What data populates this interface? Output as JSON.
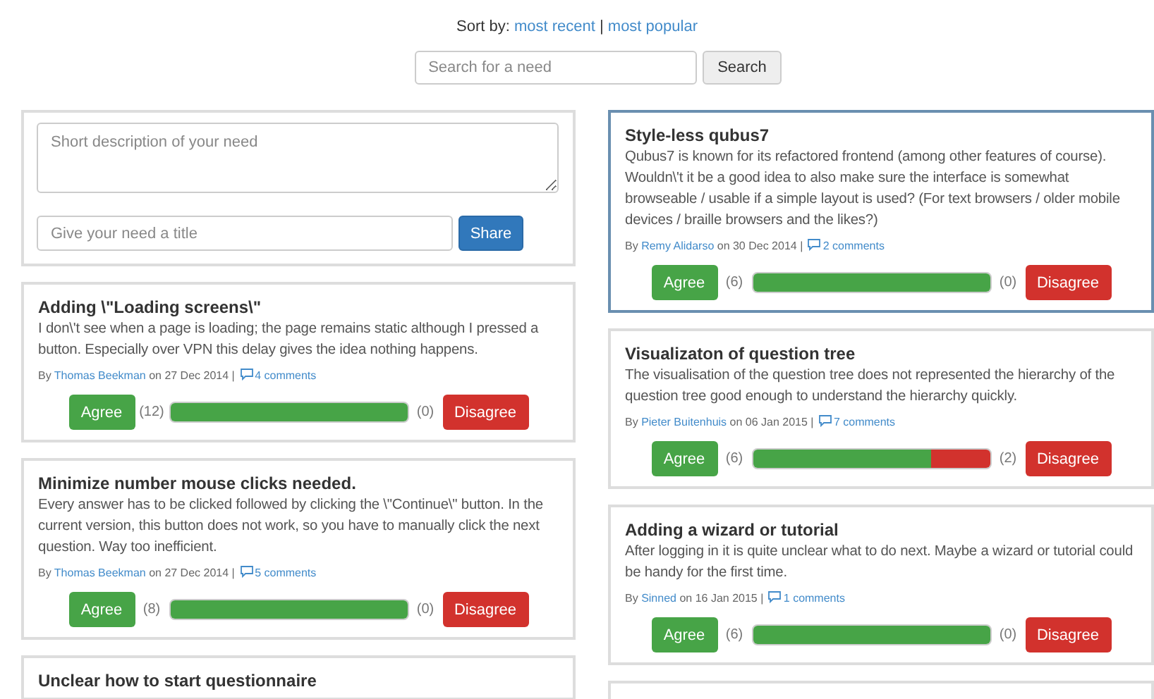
{
  "sort": {
    "label": "Sort by:",
    "options": [
      {
        "label": "most recent"
      },
      {
        "label": "most popular"
      }
    ],
    "separator": "|"
  },
  "search": {
    "placeholder": "Search for a need",
    "button": "Search"
  },
  "new_need": {
    "description_placeholder": "Short description of your need",
    "title_placeholder": "Give your need a title",
    "button": "Share"
  },
  "columns": [
    {
      "needs": [
        {
          "title": "Adding \\\"Loading screens\\\"",
          "body": "I don\\'t see when a page is loading; the page remains static although I pressed a button. Especially over VPN this delay gives the idea nothing happens.",
          "by": "By",
          "author": "Thomas Beekman",
          "date": "on 27 Dec 2014 |",
          "comments": "4 comments",
          "agree": "Agree",
          "agree_count": "(12)",
          "level": 1,
          "disagree_count": "(0)",
          "disagree": "Disagree",
          "highlighted": false
        },
        {
          "title": "Minimize number mouse clicks needed.",
          "body": "Every answer has to be clicked followed by clicking the \\\"Continue\\\" button. In the current version, this button does not work, so you have to manually click the next question. Way too inefficient.",
          "by": "By",
          "author": "Thomas Beekman",
          "date": "on 27 Dec 2014 |",
          "comments": "5 comments",
          "agree": "Agree",
          "agree_count": "(8)",
          "level": 1,
          "disagree_count": "(0)",
          "disagree": "Disagree",
          "highlighted": false
        },
        {
          "title": "Unclear how to start questionnaire",
          "highlighted": false
        }
      ]
    },
    {
      "needs": [
        {
          "title": "Style-less qubus7",
          "body": "Qubus7 is known for its refactored frontend (among other features of course). Wouldn\\'t it be a good idea to also make sure the interface is somewhat browseable / usable if a simple layout is used? (For text browsers / older mobile devices / braille browsers and the likes?)",
          "by": "By",
          "author": "Remy Alidarso",
          "date": "on 30 Dec 2014 |",
          "comments": "2 comments",
          "agree": "Agree",
          "agree_count": "(6)",
          "level": 1,
          "disagree_count": "(0)",
          "disagree": "Disagree",
          "highlighted": true
        },
        {
          "title": "Visualizaton of question tree",
          "body": "The visualisation of the question tree does not represented the hierarchy of the question tree good enough to understand the hierarchy quickly.",
          "by": "By",
          "author": "Pieter Buitenhuis",
          "date": "on 06 Jan 2015 |",
          "comments": "7 comments",
          "agree": "Agree",
          "agree_count": "(6)",
          "level": 0.75,
          "disagree_count": "(2)",
          "disagree": "Disagree",
          "highlighted": false
        },
        {
          "title": "Adding a wizard or tutorial",
          "body": "After logging in it is quite unclear what to do next. Maybe a wizard or tutorial could be handy for the first time.",
          "by": "By",
          "author": "Sinned",
          "date": "on 16 Jan 2015 |",
          "comments": "1 comments",
          "agree": "Agree",
          "agree_count": "(6)",
          "level": 1,
          "disagree_count": "(0)",
          "disagree": "Disagree",
          "highlighted": false
        },
        {
          "highlighted": false
        }
      ]
    }
  ]
}
